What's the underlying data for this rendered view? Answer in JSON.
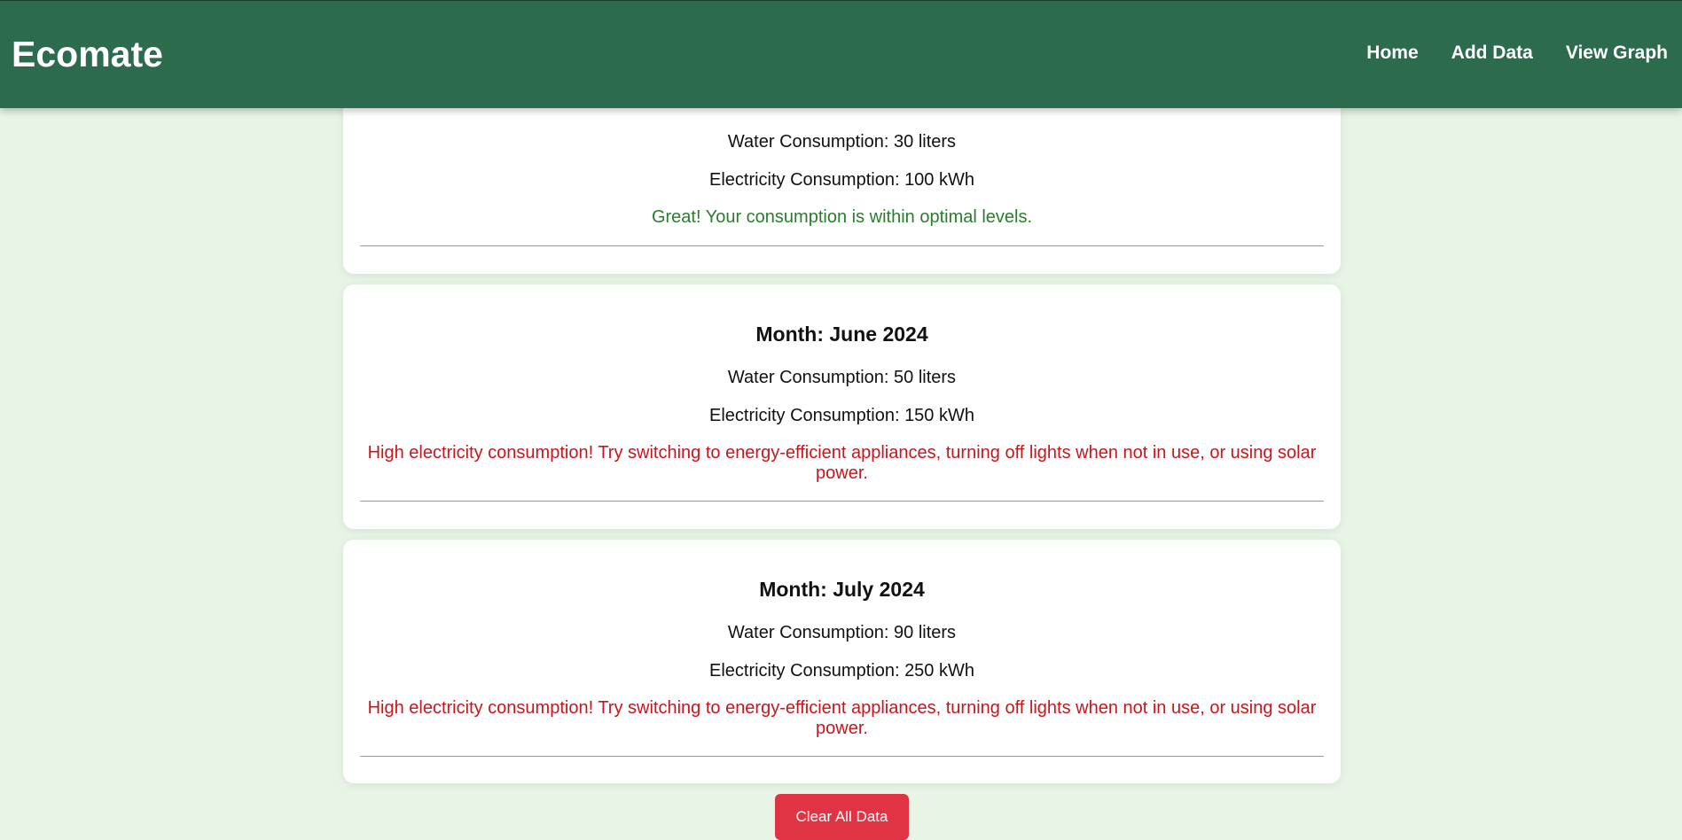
{
  "header": {
    "brand": "Ecomate",
    "nav": [
      {
        "label": "Home"
      },
      {
        "label": "Add Data"
      },
      {
        "label": "View Graph"
      }
    ]
  },
  "records": [
    {
      "month": "",
      "water": "Water Consumption: 30 liters",
      "electricity": "Electricity Consumption: 100 kWh",
      "tip": "Great! Your consumption is within optimal levels.",
      "status": "good"
    },
    {
      "month": "Month: June 2024",
      "water": "Water Consumption: 50 liters",
      "electricity": "Electricity Consumption: 150 kWh",
      "tip": "High electricity consumption! Try switching to energy-efficient appliances, turning off lights when not in use, or using solar power.",
      "status": "bad"
    },
    {
      "month": "Month: July 2024",
      "water": "Water Consumption: 90 liters",
      "electricity": "Electricity Consumption: 250 kWh",
      "tip": "High electricity consumption! Try switching to energy-efficient appliances, turning off lights when not in use, or using solar power.",
      "status": "bad"
    }
  ],
  "actions": {
    "clear_label": "Clear All Data"
  },
  "colors": {
    "header_bg": "#2d6b4f",
    "page_bg": "#e8f4e6",
    "good": "#2a7d2e",
    "bad": "#c8161d",
    "danger_button": "#e03444"
  }
}
